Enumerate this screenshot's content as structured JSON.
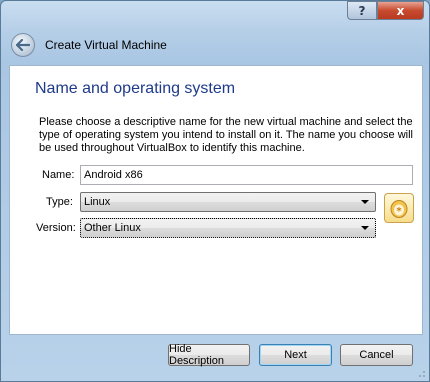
{
  "titlebar": {
    "help_label": "?",
    "close_label": "x"
  },
  "wizard": {
    "title": "Create Virtual Machine"
  },
  "page": {
    "heading": "Name and operating system",
    "description": "Please choose a descriptive name for the new virtual machine and select the type of operating system you intend to install on it. The name you choose will be used throughout VirtualBox to identify this machine."
  },
  "form": {
    "name_label": "Name:",
    "name_value": "Android x86",
    "type_label": "Type:",
    "type_value": "Linux",
    "version_label": "Version:",
    "version_value": "Other Linux"
  },
  "buttons": {
    "hide_description": "Hide Description",
    "next": "Next",
    "cancel": "Cancel"
  },
  "icons": {
    "back": "back-arrow-icon",
    "os": "linux-os-icon"
  },
  "colors": {
    "heading": "#1e3a8a",
    "close": "#c84a2f"
  }
}
